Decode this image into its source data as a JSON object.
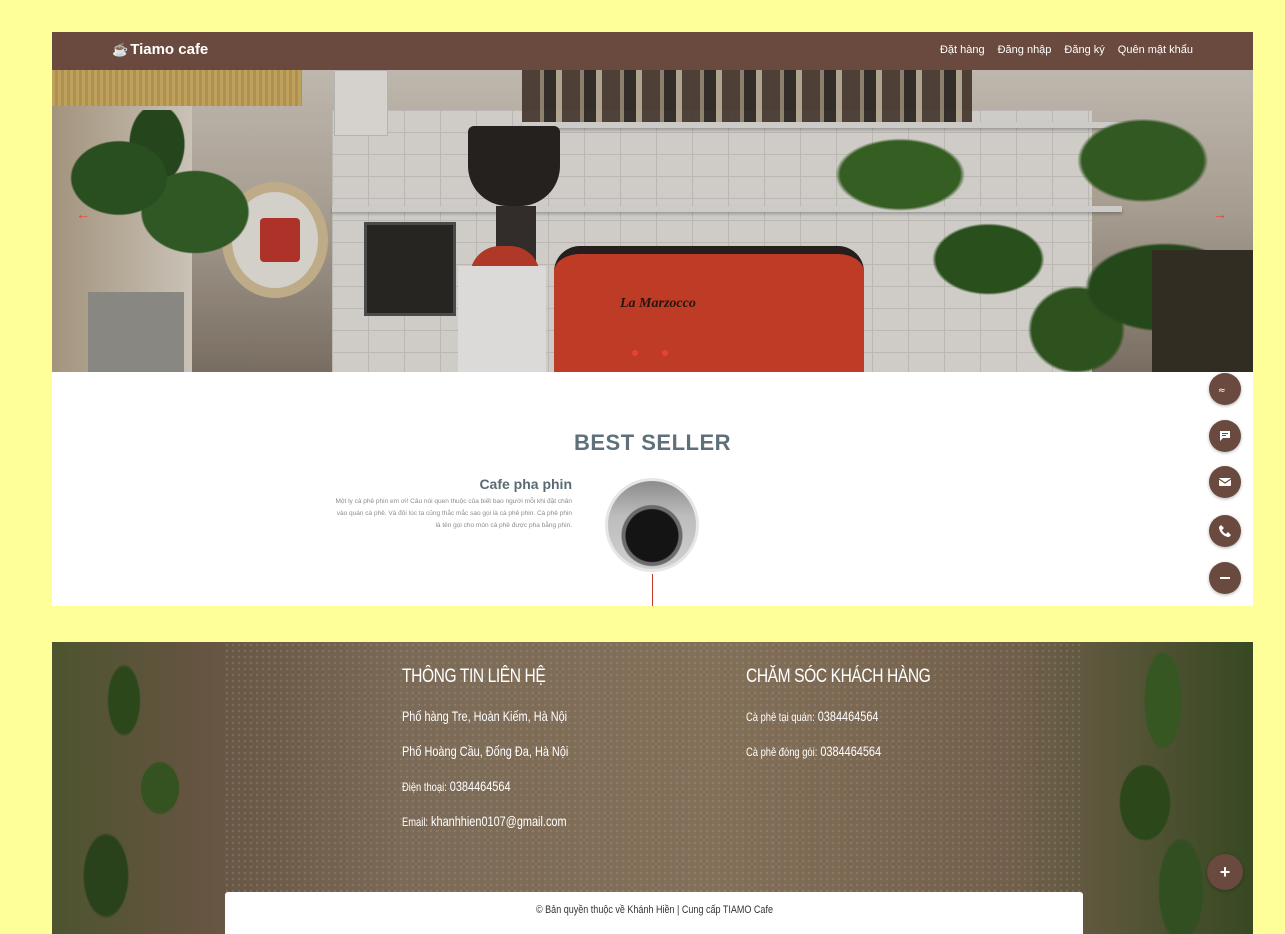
{
  "nav": {
    "brand_icon": "coffee-cup-icon",
    "brand": "Tiamo cafe",
    "links": [
      "Đặt hàng",
      "Đăng nhập",
      "Đăng ký",
      "Quên mật khẩu"
    ]
  },
  "hero": {
    "machine_label": "La Marzocco",
    "prev_icon": "arrow-left-icon",
    "next_icon": "arrow-right-icon",
    "slide_count": 2
  },
  "best_seller": {
    "title": "BEST SELLER",
    "product_name": "Cafe pha phin",
    "product_desc": "Một ly cà phê phin em ơi! Câu nói quen thuộc của biết bao người mỗi khi đặt chân vào quán cà phê. Và đôi lúc ta cũng thắc mắc sao gọi là cà phê phin. Cà phê phin là tên gọi cho món cà phê được pha bằng phin."
  },
  "floating_actions": [
    "zalo-icon",
    "chat-icon",
    "mail-icon",
    "phone-icon",
    "minus-icon"
  ],
  "footer": {
    "contact_title": "THÔNG TIN LIÊN HỆ",
    "address1": "Phố hàng Tre, Hoàn Kiếm, Hà Nội",
    "address2": "Phố Hoàng Cầu, Đống Đa, Hà Nội",
    "phone_label": "Điện thoại:",
    "phone": "0384464564",
    "email_label": "Email:",
    "email": "khanhhien0107@gmail.com",
    "care_title": "CHĂM SÓC KHÁCH HÀNG",
    "care1_label": "Cà phê tại quán:",
    "care1": "0384464564",
    "care2_label": "Cà phê đóng gói:",
    "care2": "0384464564",
    "copyright": "© Bản quyền thuộc về Khánh Hiền | Cung cấp TIAMO Cafe",
    "plus_icon": "plus-icon"
  },
  "colors": {
    "page_bg": "#ffff99",
    "brand_brown": "#6a4a3f",
    "accent_red": "#e8413a",
    "title_slate": "#5e7079"
  }
}
